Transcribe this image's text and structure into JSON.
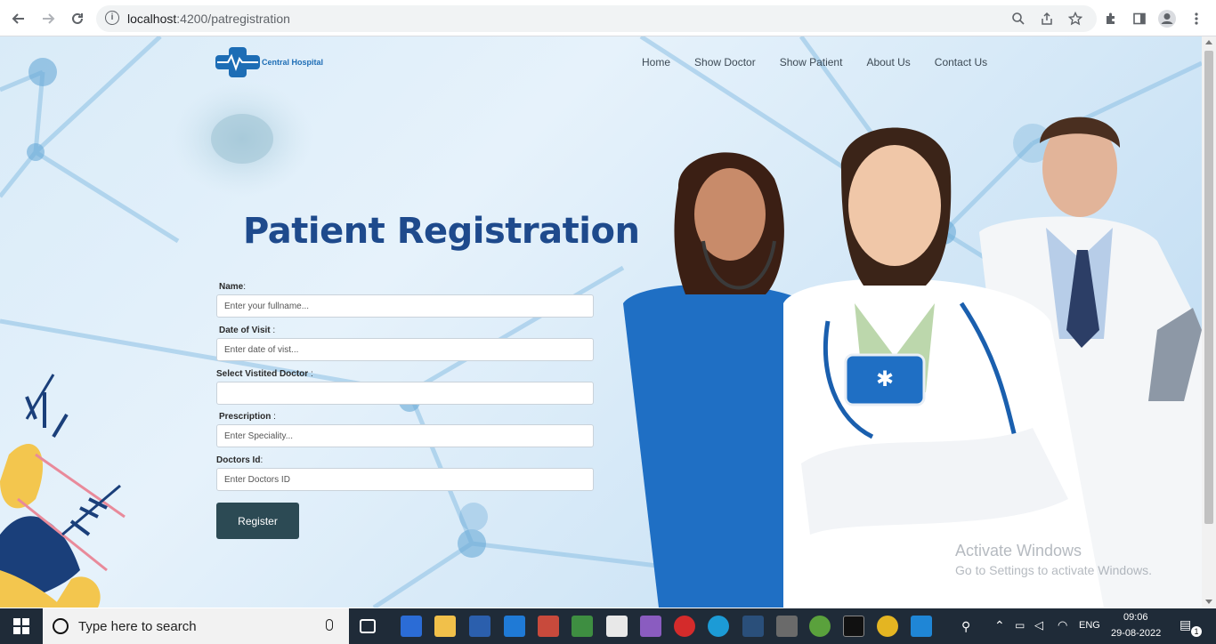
{
  "browser": {
    "url_host": "localhost",
    "url_path": ":4200/patregistration"
  },
  "site": {
    "logo_text": "Central Hospital",
    "nav": [
      {
        "label": "Home"
      },
      {
        "label": "Show Doctor"
      },
      {
        "label": "Show Patient"
      },
      {
        "label": "About Us"
      },
      {
        "label": "Contact Us"
      }
    ]
  },
  "form": {
    "title": "Patient Registration",
    "fields": [
      {
        "label": "Name",
        "colon": ":",
        "placeholder": "Enter your fullname...",
        "value": ""
      },
      {
        "label": "Date of Visit",
        "colon": " :",
        "placeholder": "Enter date of vist...",
        "value": ""
      },
      {
        "label": "Select Vistited Doctor",
        "colon": " :",
        "placeholder": "",
        "value": ""
      },
      {
        "label": "Prescription",
        "colon": " :",
        "placeholder": "Enter Speciality...",
        "value": ""
      },
      {
        "label": "Doctors Id",
        "colon": ":",
        "placeholder": "Enter Doctors ID",
        "value": ""
      }
    ],
    "submit_label": "Register"
  },
  "watermark": {
    "line1": "Activate Windows",
    "line2": "Go to Settings to activate Windows."
  },
  "taskbar": {
    "search_placeholder": "Type here to search",
    "language": "ENG",
    "time": "09:06",
    "date": "29-08-2022",
    "notification_count": "1"
  },
  "colors": {
    "title": "#1e4a8c",
    "button": "#2c4a54",
    "taskbar": "#1f2b38"
  }
}
